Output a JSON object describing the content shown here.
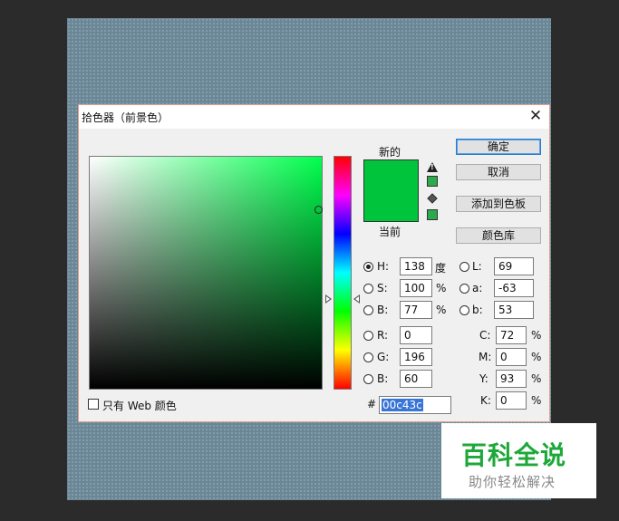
{
  "dialog": {
    "title": "拾色器（前景色）"
  },
  "swatches": {
    "new_label": "新的",
    "current_label": "当前",
    "new_color": "#00c43c",
    "current_color": "#00c43c"
  },
  "buttons": {
    "ok": "确定",
    "cancel": "取消",
    "add_swatch": "添加到色板",
    "libraries": "颜色库"
  },
  "hsb": {
    "h_label": "H:",
    "h_value": "138",
    "h_unit": "度",
    "s_label": "S:",
    "s_value": "100",
    "s_unit": "%",
    "b_label": "B:",
    "b_value": "77",
    "b_unit": "%"
  },
  "rgb": {
    "r_label": "R:",
    "r_value": "0",
    "g_label": "G:",
    "g_value": "196",
    "b_label": "B:",
    "b_value": "60"
  },
  "lab": {
    "l_label": "L:",
    "l_value": "69",
    "a_label": "a:",
    "a_value": "-63",
    "b_label": "b:",
    "b_value": "53"
  },
  "cmyk": {
    "c_label": "C:",
    "c_value": "72",
    "m_label": "M:",
    "m_value": "0",
    "y_label": "Y:",
    "y_value": "93",
    "k_label": "K:",
    "k_value": "0",
    "unit": "%"
  },
  "hex": {
    "label": "#",
    "value": "00c43c"
  },
  "web_only": {
    "label": "只有 Web 颜色",
    "checked": false
  },
  "watermark": {
    "main": "百科全说",
    "sub": "助你轻松解决"
  }
}
